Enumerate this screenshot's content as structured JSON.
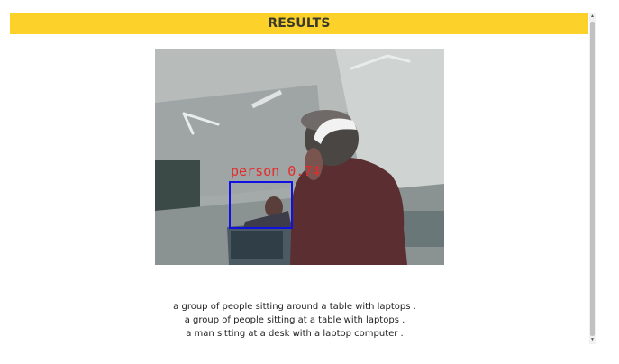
{
  "header": {
    "title": "RESULTS",
    "background_color": "#fcd129"
  },
  "result_image": {
    "detection_label": "person 0.74",
    "box_color": "#1010e0",
    "label_color": "#e52a2a"
  },
  "captions": [
    "a group of people sitting around a table with laptops .",
    "a group of people sitting at a table with laptops .",
    "a man sitting at a desk with a laptop computer ."
  ],
  "scrollbar": {
    "up_icon": "chevron-up-icon",
    "down_icon": "chevron-down-icon"
  }
}
